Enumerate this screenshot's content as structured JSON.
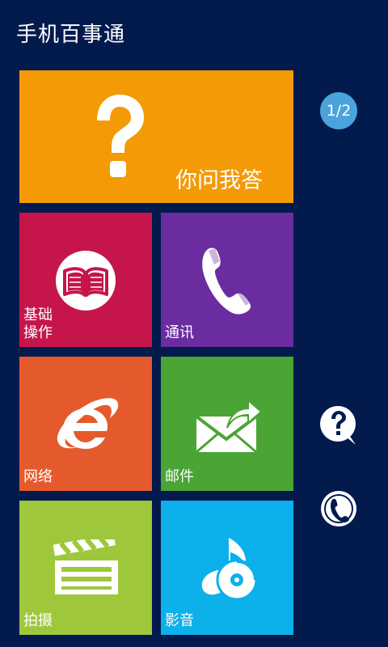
{
  "app": {
    "title": "手机百事通"
  },
  "tiles": {
    "qa": {
      "label": "你问我答",
      "icon": "question-mark-icon",
      "color": "#f39a06"
    },
    "basic": {
      "label": "基础\n操作",
      "icon": "book-icon",
      "color": "#c6154b"
    },
    "comm": {
      "label": "通讯",
      "icon": "phone-icon",
      "color": "#6b2c9f"
    },
    "net": {
      "label": "网络",
      "icon": "browser-e-icon",
      "color": "#e55a2c"
    },
    "mail": {
      "label": "邮件",
      "icon": "envelope-forward-icon",
      "color": "#4aa534"
    },
    "shoot": {
      "label": "拍摄",
      "icon": "clapperboard-icon",
      "color": "#9fc73b"
    },
    "media": {
      "label": "影音",
      "icon": "music-disc-icon",
      "color": "#0cb0eb"
    }
  },
  "pager": {
    "indicator": "1/2"
  },
  "side_buttons": {
    "qa": {
      "icon": "question-bubble-icon"
    },
    "call": {
      "icon": "phone-circle-icon"
    }
  },
  "colors": {
    "background": "#031a4d",
    "pager": "#4ba3dc"
  }
}
